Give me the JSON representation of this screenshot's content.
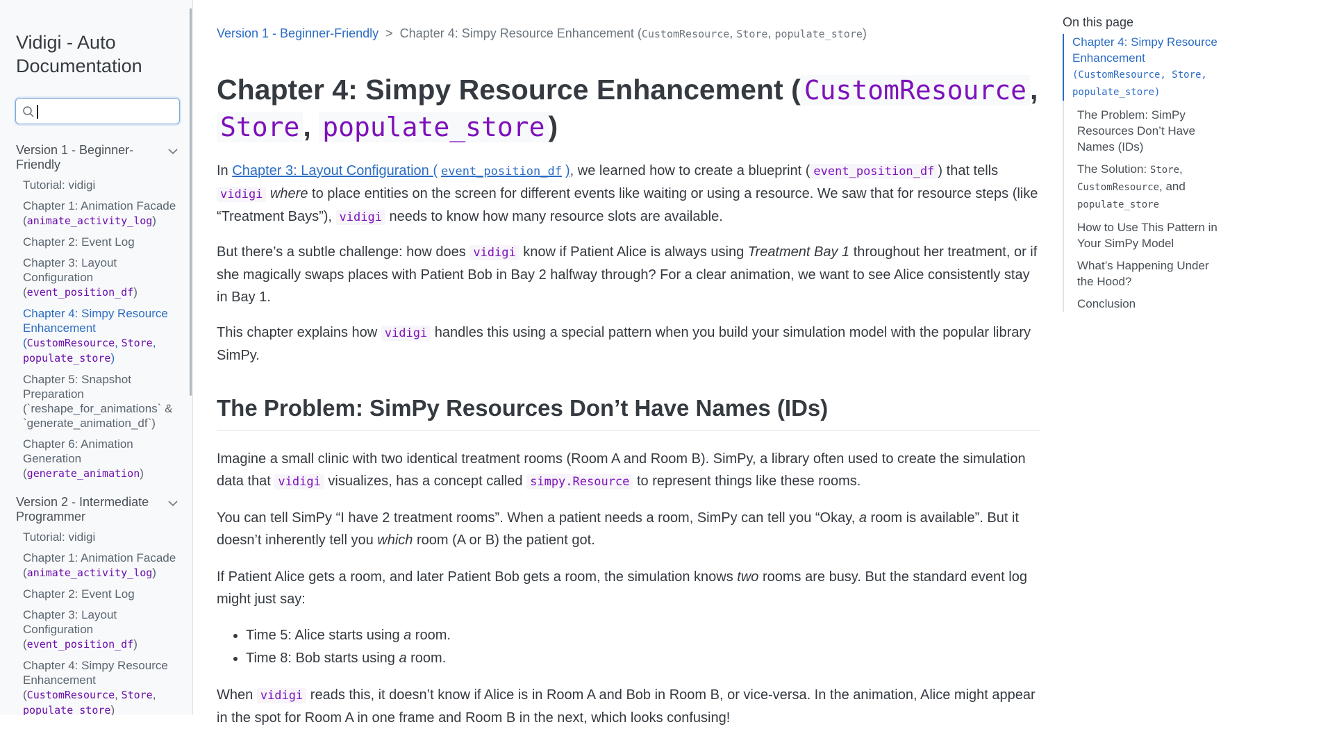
{
  "sidebar": {
    "site_title": "Vidigi - Auto Documentation",
    "search": {
      "placeholder": "",
      "value": ""
    },
    "sections": [
      {
        "title": "Version 1 - Beginner-Friendly",
        "items": [
          {
            "label": "Tutorial: vidigi"
          },
          {
            "label": "Chapter 1: Animation Facade (",
            "code": "animate_activity_log",
            "suffix": ")"
          },
          {
            "label": "Chapter 2: Event Log"
          },
          {
            "label": "Chapter 3: Layout Configuration (",
            "code": "event_position_df",
            "suffix": ")"
          },
          {
            "label": "Chapter 4: Simpy Resource Enhancement (",
            "code": "CustomResource",
            "sep1": ", ",
            "code2": "Store",
            "sep2": ", ",
            "code3": "populate_store",
            "suffix": ")"
          },
          {
            "label": "Chapter 5: Snapshot Preparation (`reshape_for_animations` & `generate_animation_df`)"
          },
          {
            "label": "Chapter 6: Animation Generation (",
            "code": "generate_animation",
            "suffix": ")"
          }
        ]
      },
      {
        "title": "Version 2 - Intermediate Programmer",
        "items": [
          {
            "label": "Tutorial: vidigi"
          },
          {
            "label": "Chapter 1: Animation Facade (",
            "code": "animate_activity_log",
            "suffix": ")"
          },
          {
            "label": "Chapter 2: Event Log"
          },
          {
            "label": "Chapter 3: Layout Configuration (",
            "code": "event_position_df",
            "suffix": ")"
          },
          {
            "label": "Chapter 4: Simpy Resource Enhancement (",
            "code": "CustomResource",
            "sep1": ", ",
            "code2": "Store",
            "sep2": ", ",
            "code3": "populate_store",
            "suffix": ")"
          }
        ]
      }
    ]
  },
  "breadcrumb": {
    "link": "Version 1 - Beginner-Friendly",
    "separator": ">",
    "current": "Chapter 4: Simpy Resource Enhancement (",
    "code1": "CustomResource",
    "sep1": ", ",
    "code2": "Store",
    "sep2": ", ",
    "code3": "populate_store",
    "close": ")"
  },
  "page": {
    "title_text": "Chapter 4: Simpy Resource Enhancement (",
    "title_code1": "CustomResource",
    "title_sep1": ",",
    "title_code2": "Store",
    "title_sep2": ",",
    "title_code3": "populate_store",
    "title_close": ")",
    "p1": {
      "t1": "In ",
      "link_text": "Chapter 3: Layout Configuration (",
      "link_code": "event_position_df",
      "link_close": ")",
      "t2": ", we learned how to create a blueprint (",
      "code1": "event_position_df",
      "t3": ") that tells ",
      "code2": "vidigi",
      "em1": "where",
      "t4": " to place entities on the screen for different events like waiting or using a resource. We saw that for resource steps (like “Treatment Bays”), ",
      "code3": "vidigi",
      "t5": " needs to know how many resource slots are available."
    },
    "p2": {
      "t1": "But there’s a subtle challenge: how does ",
      "code1": "vidigi",
      "t2": " know if Patient Alice is always using ",
      "em1": "Treatment Bay 1",
      "t3": " throughout her treatment, or if she magically swaps places with Patient Bob in Bay 2 halfway through? For a clear animation, we want to see Alice consistently stay in Bay 1."
    },
    "p3": {
      "t1": "This chapter explains how ",
      "code1": "vidigi",
      "t2": " handles this using a special pattern when you build your simulation model with the popular library SimPy."
    },
    "section_heading": "The Problem: SimPy Resources Don’t Have Names (IDs)",
    "p4": {
      "t1": "Imagine a small clinic with two identical treatment rooms (Room A and Room B). SimPy, a library often used to create the simulation data that ",
      "code1": "vidigi",
      "t2": " visualizes, has a concept called ",
      "code2": "simpy.Resource",
      "t3": " to represent things like these rooms."
    },
    "p5": {
      "t1": "You can tell SimPy “I have 2 treatment rooms”. When a patient needs a room, SimPy can tell you “Okay, ",
      "em1": "a",
      "t2": " room is available”. But it doesn’t inherently tell you ",
      "em2": "which",
      "t3": " room (A or B) the patient got."
    },
    "p6": {
      "t1": "If Patient Alice gets a room, and later Patient Bob gets a room, the simulation knows ",
      "em1": "two",
      "t2": " rooms are busy. But the standard event log might just say:"
    },
    "bullets": [
      {
        "t1": "Time 5: Alice starts using ",
        "em": "a",
        "t2": " room."
      },
      {
        "t1": "Time 8: Bob starts using ",
        "em": "a",
        "t2": " room."
      }
    ],
    "p7": {
      "t1": "When ",
      "code1": "vidigi",
      "t2": " reads this, it doesn’t know if Alice is in Room A and Bob in Room B, or vice-versa. In the animation, Alice might appear in the spot for Room A in one frame and Room B in the next, which looks confusing!"
    }
  },
  "toc": {
    "title": "On this page",
    "items": [
      {
        "label": "Chapter 4: Simpy Resource Enhancement",
        "code": "(CustomResource, Store, populate_store)",
        "active": true
      },
      {
        "label": "The Problem: SimPy Resources Don’t Have Names (IDs)"
      },
      {
        "label": "The Solution: ",
        "code": "Store",
        "sep": ", ",
        "code2": "CustomResource",
        "mid": ", and ",
        "code3": "populate_store"
      },
      {
        "label": "How to Use This Pattern in Your SimPy Model"
      },
      {
        "label": "What’s Happening Under the Hood?"
      },
      {
        "label": "Conclusion"
      }
    ]
  },
  "colors": {
    "link": "#2b6cc4",
    "code": "#7d12ba",
    "heading": "#343a40",
    "sidebar_bg": "#f8f9fa"
  }
}
